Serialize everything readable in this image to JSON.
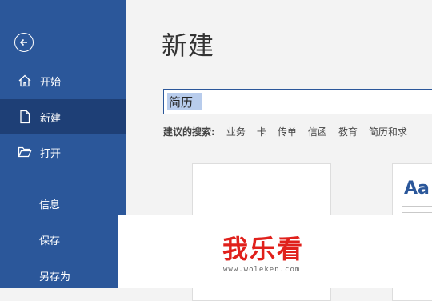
{
  "sidebar": {
    "items": [
      {
        "label": "开始",
        "icon": "home-icon"
      },
      {
        "label": "新建",
        "icon": "new-document-icon"
      },
      {
        "label": "打开",
        "icon": "folder-open-icon"
      },
      {
        "label": "信息"
      },
      {
        "label": "保存"
      },
      {
        "label": "另存为"
      }
    ]
  },
  "main": {
    "title": "新建",
    "search": {
      "value": "简历"
    },
    "suggestions": {
      "label": "建议的搜索:",
      "keywords": [
        "业务",
        "卡",
        "传单",
        "信函",
        "教育",
        "简历和求"
      ]
    },
    "template_preview_text": "Aa"
  },
  "watermark": {
    "logo": "我乐看",
    "url": "www.woleken.com"
  },
  "colors": {
    "sidebar": "#2b579a",
    "sidebar_active": "#1e3f76",
    "logo": "#e0201b"
  }
}
